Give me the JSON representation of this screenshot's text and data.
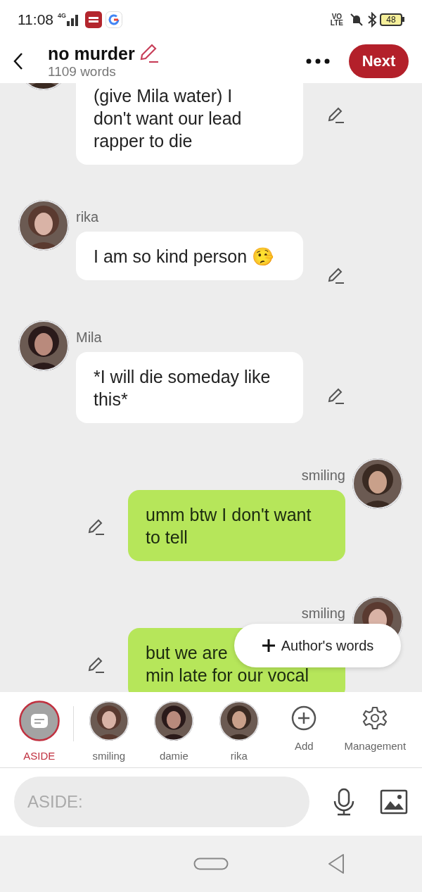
{
  "status_bar": {
    "time": "11:08",
    "network": "4G",
    "volte": [
      "VO",
      "LTE"
    ],
    "battery": "48"
  },
  "header": {
    "title": "no murder",
    "subtitle": "1109 words",
    "next_button": "Next"
  },
  "messages": [
    {
      "kind": "incoming",
      "lines": [
        "(give Mila water) I",
        "don't want our lead",
        "rapper to die"
      ]
    },
    {
      "kind": "incoming",
      "sender": "rika",
      "lines": [
        "I am so kind person 🤥"
      ]
    },
    {
      "kind": "incoming",
      "sender": "Mila",
      "lines": [
        "*I will die someday like",
        "this*"
      ]
    },
    {
      "kind": "outgoing",
      "sender": "smiling",
      "lines": [
        "umm btw I don't want",
        "to tell"
      ]
    },
    {
      "kind": "outgoing",
      "sender": "smiling",
      "lines": [
        "but we are",
        "min late for our vocal"
      ]
    }
  ],
  "popup": {
    "label": "Author's words"
  },
  "cast_bar": [
    {
      "kind": "aside",
      "label": "ASIDE",
      "selected": true
    },
    {
      "kind": "character",
      "label": "smiling",
      "selected": false
    },
    {
      "kind": "character",
      "label": "damie",
      "selected": false
    },
    {
      "kind": "character",
      "label": "rika",
      "selected": false
    },
    {
      "kind": "add",
      "label": "Add",
      "selected": false
    },
    {
      "kind": "manage",
      "label": "Management",
      "selected": false
    }
  ],
  "input": {
    "placeholder": "ASIDE:"
  }
}
